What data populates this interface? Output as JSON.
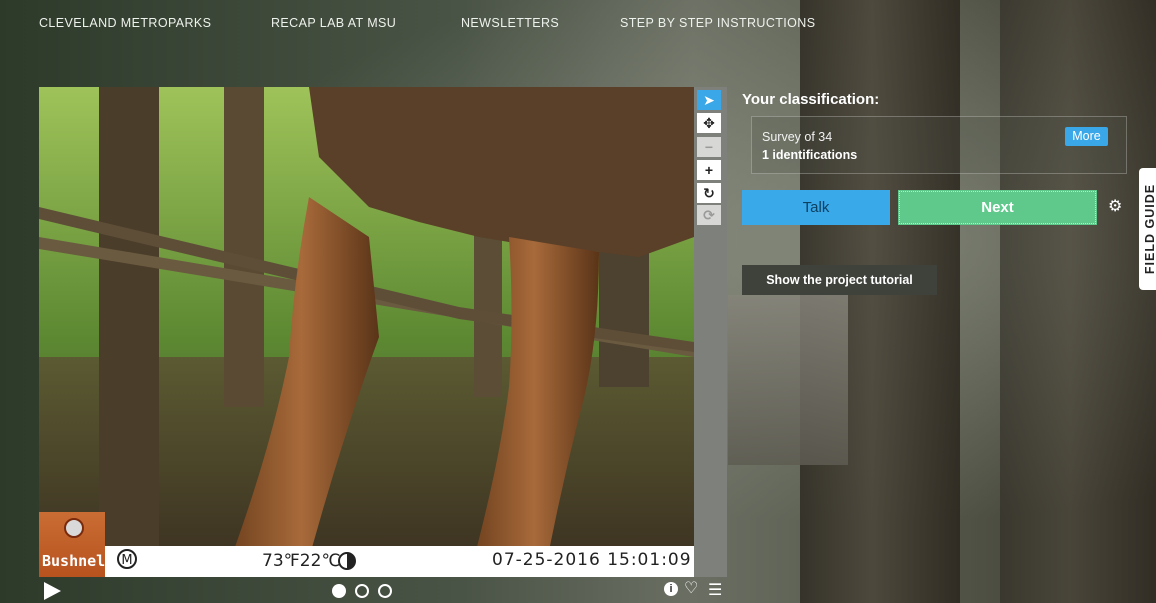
{
  "nav": {
    "items": [
      {
        "label": "CLEVELAND METROPARKS"
      },
      {
        "label": "RECAP LAB AT MSU"
      },
      {
        "label": "NEWSLETTERS"
      },
      {
        "label": "STEP BY STEP INSTRUCTIONS"
      }
    ]
  },
  "viewer": {
    "camera_brand": "Bushnell",
    "stamp": {
      "moon_symbol": "M",
      "temperature": "73℉22℃",
      "datetime": "07-25-2016 15:01:09"
    },
    "tools": [
      {
        "icon": "pointer-icon",
        "active": true
      },
      {
        "icon": "move-icon"
      },
      {
        "icon": "zoom-out-icon",
        "disabled": true
      },
      {
        "icon": "zoom-in-icon"
      },
      {
        "icon": "rotate-icon"
      },
      {
        "icon": "reset-icon",
        "disabled": true
      }
    ],
    "frames": {
      "count": 3,
      "current": 1
    }
  },
  "classification": {
    "title": "Your classification:",
    "survey_label": "Survey of 34",
    "identifications": "1 identifications",
    "more_label": "More"
  },
  "actions": {
    "talk_label": "Talk",
    "next_label": "Next",
    "tutorial_label": "Show the project tutorial"
  },
  "field_guide": {
    "label": "FIELD GUIDE"
  },
  "colors": {
    "accent_blue": "#3aa7e8",
    "next_green": "#5fc98c"
  }
}
